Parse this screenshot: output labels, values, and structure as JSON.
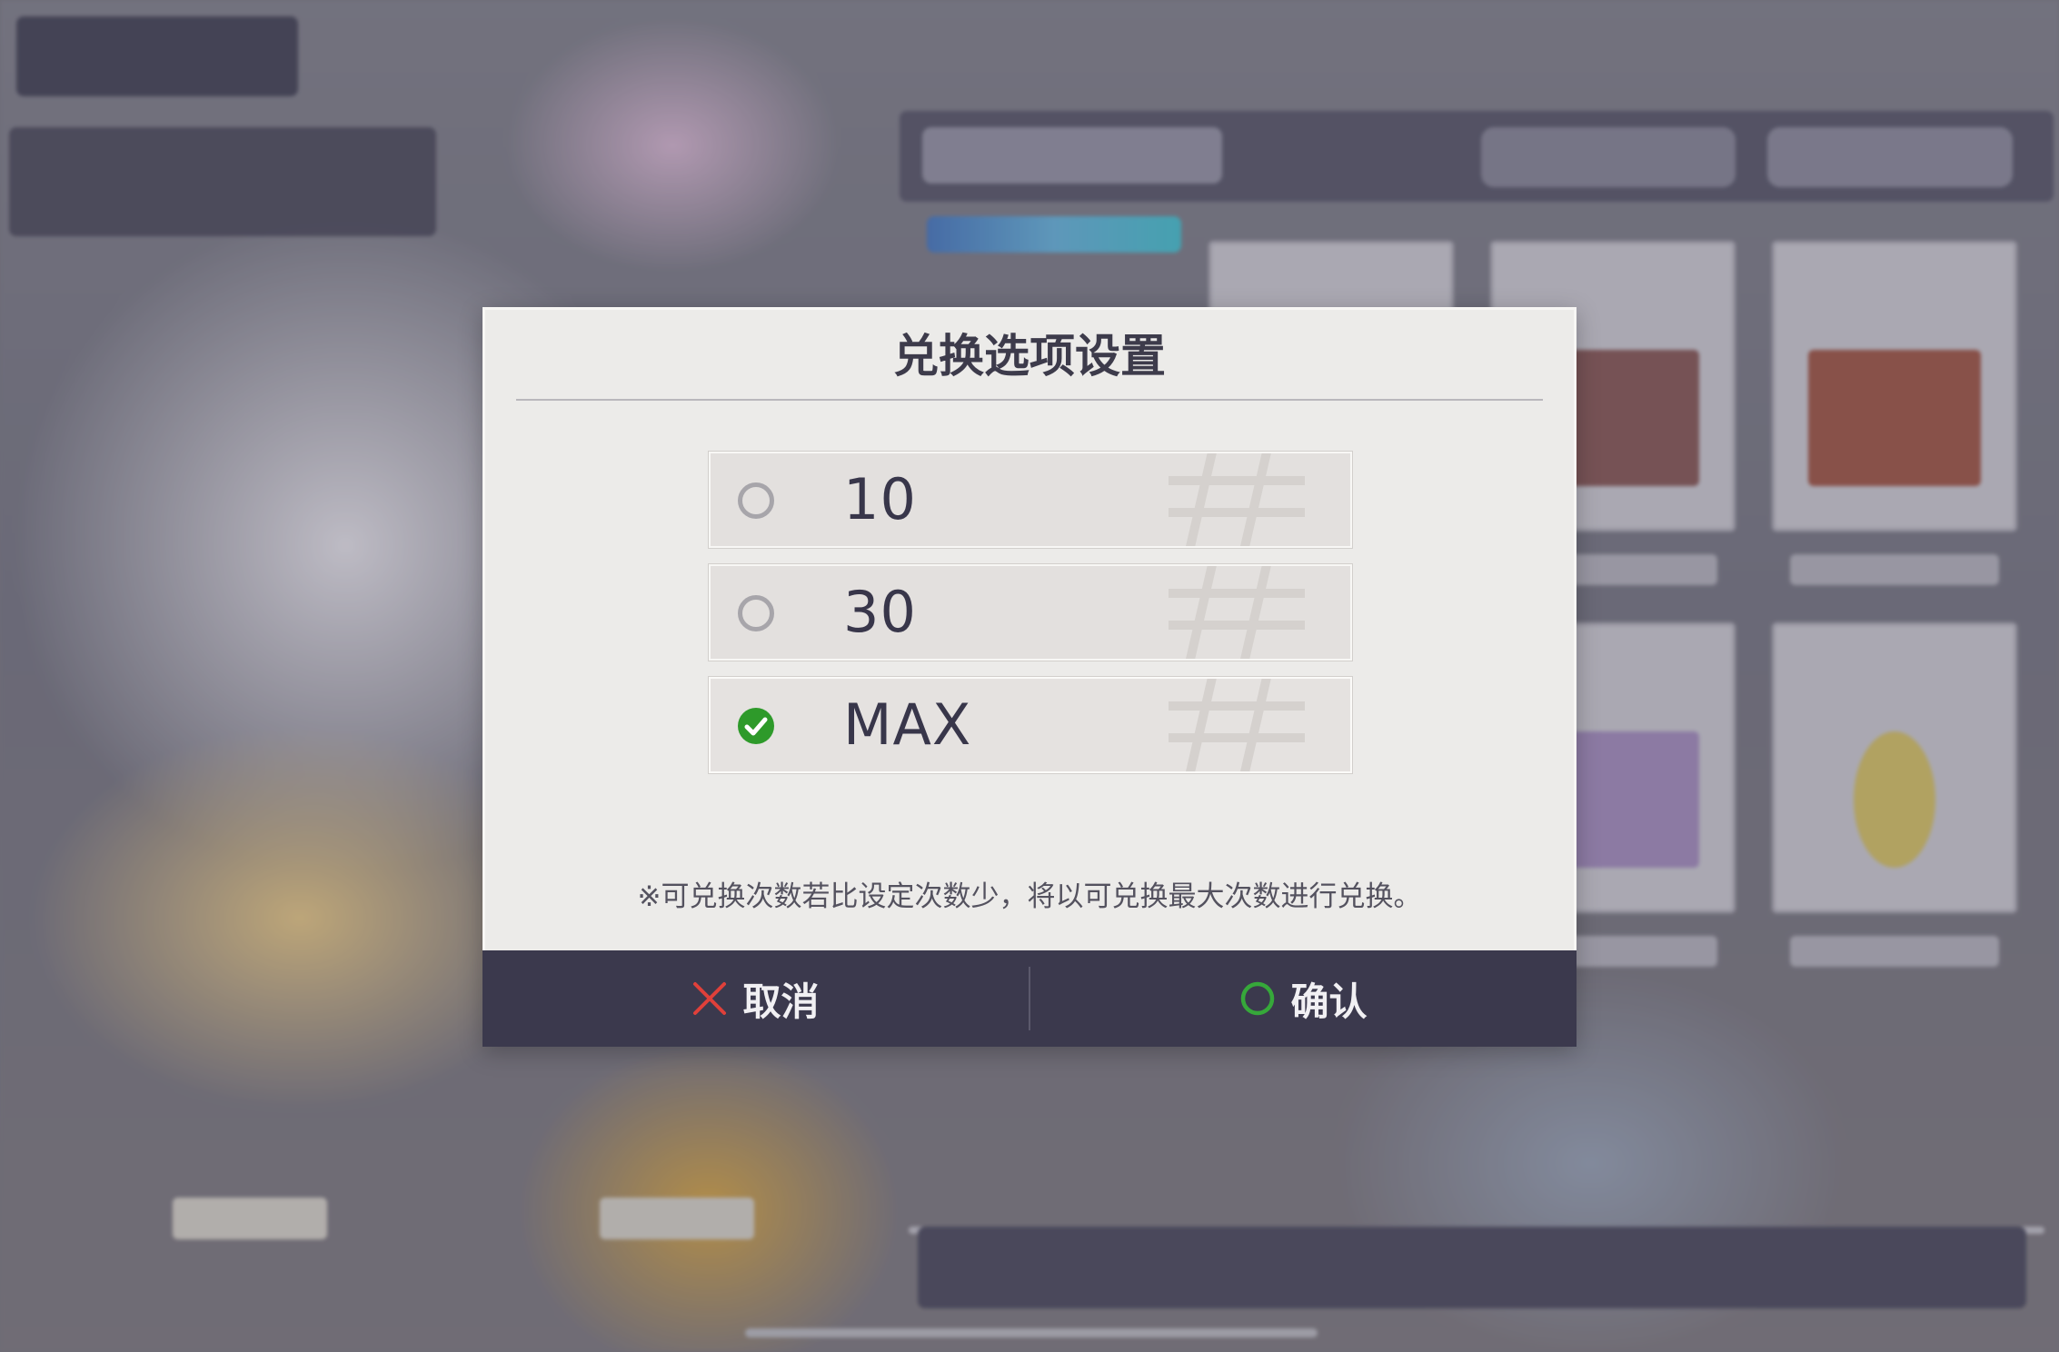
{
  "dialog": {
    "title": "兑换选项设置",
    "options": [
      {
        "label": "10",
        "selected": false
      },
      {
        "label": "30",
        "selected": false
      },
      {
        "label": "MAX",
        "selected": true
      }
    ],
    "note": "※可兑换次数若比设定次数少，将以可兑换最大次数进行兑换。",
    "cancel_label": "取消",
    "confirm_label": "确认"
  },
  "colors": {
    "dialog_bg": "#ecebe9",
    "footer_bg": "#3b394d",
    "title_text": "#3d3b4b",
    "selected_check": "#2e9a2a",
    "cancel_icon": "#e0403a",
    "confirm_icon": "#36a83a"
  },
  "icons": {
    "cancel": "close-icon",
    "confirm": "circle-icon",
    "selected": "check-circle-icon",
    "unselected": "radio-empty-icon"
  }
}
